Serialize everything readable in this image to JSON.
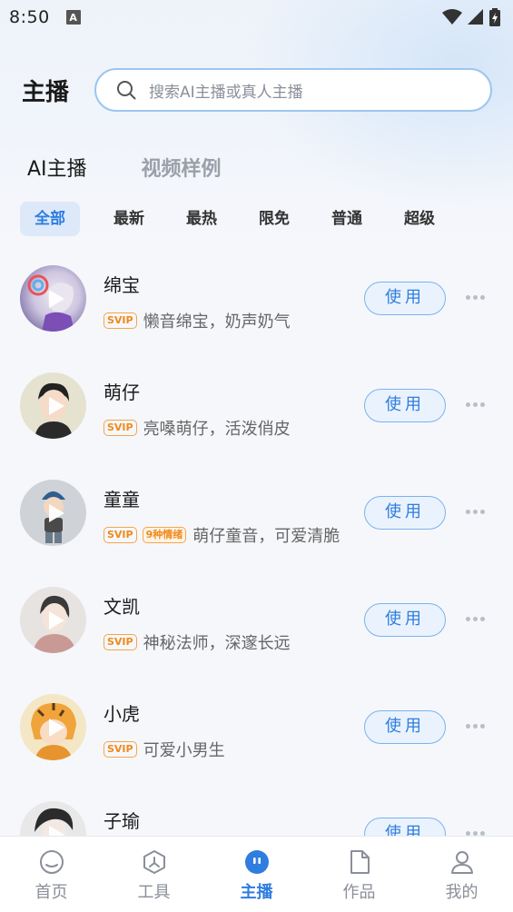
{
  "status_bar": {
    "time": "8:50",
    "notif_icon": "A"
  },
  "header": {
    "title": "主播",
    "search_placeholder": "搜索AI主播或真人主播"
  },
  "top_tabs": {
    "active": "AI主播",
    "other": "视频样例"
  },
  "filters": [
    "全部",
    "最新",
    "最热",
    "限免",
    "普通",
    "超级"
  ],
  "anchors": [
    {
      "name": "绵宝",
      "badge": "SVIP",
      "emotion": "",
      "desc": "懒音绵宝，奶声奶气",
      "action": "使用"
    },
    {
      "name": "萌仔",
      "badge": "SVIP",
      "emotion": "",
      "desc": "亮嗓萌仔，活泼俏皮",
      "action": "使用"
    },
    {
      "name": "童童",
      "badge": "SVIP",
      "emotion": "9种情绪",
      "desc": "萌仔童音，可爱清脆",
      "action": "使用"
    },
    {
      "name": "文凯",
      "badge": "SVIP",
      "emotion": "",
      "desc": "神秘法师，深邃长远",
      "action": "使用"
    },
    {
      "name": "小虎",
      "badge": "SVIP",
      "emotion": "",
      "desc": "可爱小男生",
      "action": "使用"
    },
    {
      "name": "子瑜",
      "badge": "",
      "emotion": "",
      "desc": "",
      "action": "使用"
    }
  ],
  "bottom_nav": [
    {
      "label": "首页",
      "icon": "home-icon"
    },
    {
      "label": "工具",
      "icon": "tools-icon"
    },
    {
      "label": "主播",
      "icon": "anchor-icon"
    },
    {
      "label": "作品",
      "icon": "works-icon"
    },
    {
      "label": "我的",
      "icon": "profile-icon"
    }
  ],
  "colors": {
    "accent": "#2f7ddf",
    "svip": "#f08a1c"
  }
}
